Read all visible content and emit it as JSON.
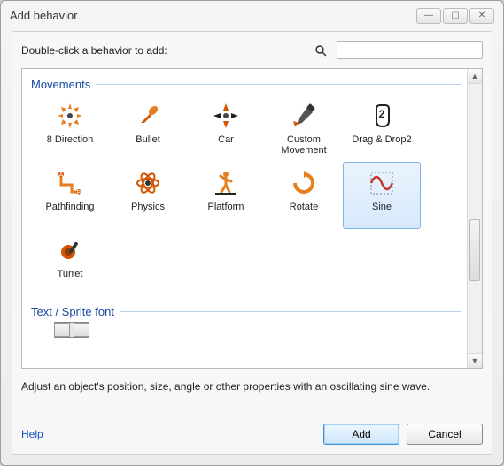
{
  "title": "Add behavior",
  "instruction": "Double-click a behavior to add:",
  "search": {
    "value": "",
    "placeholder": ""
  },
  "categories": [
    {
      "name": "Movements",
      "items": [
        {
          "label": "8 Direction",
          "icon": "eight-direction-icon",
          "selected": false
        },
        {
          "label": "Bullet",
          "icon": "bullet-icon",
          "selected": false
        },
        {
          "label": "Car",
          "icon": "car-icon",
          "selected": false
        },
        {
          "label": "Custom Movement",
          "icon": "custom-movement-icon",
          "selected": false
        },
        {
          "label": "Drag & Drop2",
          "icon": "drag-drop-icon",
          "selected": false
        },
        {
          "label": "Pathfinding",
          "icon": "pathfinding-icon",
          "selected": false
        },
        {
          "label": "Physics",
          "icon": "physics-icon",
          "selected": false
        },
        {
          "label": "Platform",
          "icon": "platform-icon",
          "selected": false
        },
        {
          "label": "Rotate",
          "icon": "rotate-icon",
          "selected": false
        },
        {
          "label": "Sine",
          "icon": "sine-icon",
          "selected": true
        },
        {
          "label": "Turret",
          "icon": "turret-icon",
          "selected": false
        }
      ]
    },
    {
      "name": "Text / Sprite font",
      "items": []
    }
  ],
  "description": "Adjust an object's position, size, angle or other properties with an oscillating sine wave.",
  "footer": {
    "help": "Help",
    "add": "Add",
    "cancel": "Cancel"
  }
}
